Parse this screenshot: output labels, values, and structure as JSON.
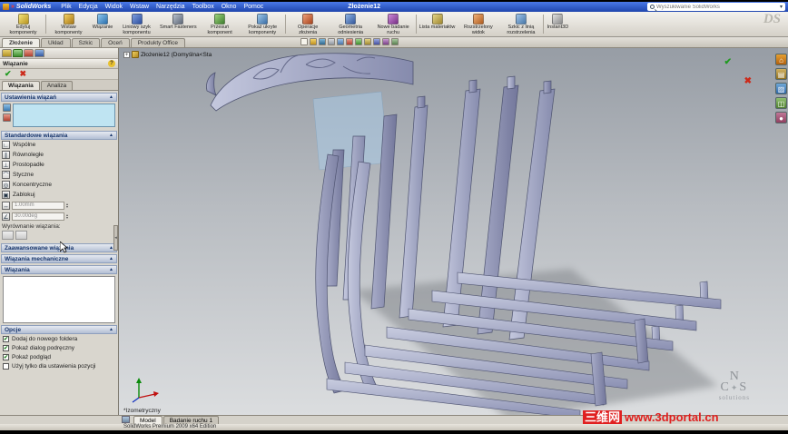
{
  "window": {
    "app": "SolidWorks",
    "doc_title": "Złożenie12",
    "search_placeholder": "Wyszukiwanie SolidWorks"
  },
  "menubar": {
    "items": [
      "Plik",
      "Edycja",
      "Widok",
      "Wstaw",
      "Narzędzia",
      "Toolbox",
      "Okno",
      "Pomoc"
    ]
  },
  "ribbon": {
    "buttons": [
      {
        "label": "Edytuj komponenty",
        "icon": "edit-component"
      },
      {
        "label": "Wstaw komponenty",
        "icon": "insert-component"
      },
      {
        "label": "Wiązanie",
        "icon": "mate"
      },
      {
        "label": "Liniowy szyk komponentu",
        "icon": "linear-component-pattern"
      },
      {
        "label": "Smart Fasteners",
        "icon": "smart-fasteners"
      },
      {
        "label": "Przesuń komponent",
        "icon": "move-component"
      },
      {
        "label": "Pokaż ukryte komponenty",
        "icon": "show-hidden-components"
      },
      {
        "label": "Operacje złożenia",
        "icon": "assembly-features"
      },
      {
        "label": "Geometria odniesienia",
        "icon": "reference-geometry"
      },
      {
        "label": "Nowe badanie ruchu",
        "icon": "new-motion-study"
      },
      {
        "label": "Lista materiałów",
        "icon": "bill-of-materials"
      },
      {
        "label": "Rozstrzelony widok",
        "icon": "exploded-view"
      },
      {
        "label": "Szkic z linią rozstrzelenia",
        "icon": "explode-line-sketch"
      },
      {
        "label": "Instant3D",
        "icon": "instant3d"
      }
    ]
  },
  "command_tabs": {
    "items": [
      "Złożenie",
      "Układ",
      "Szkic",
      "Oceń",
      "Produkty Office"
    ],
    "active": "Złożenie"
  },
  "feature_tree": {
    "root": "Złożenie12 (Domyślna<Sta",
    "expander": "+"
  },
  "property_manager": {
    "title": "Wiązanie",
    "ok": "✔",
    "cancel": "✖",
    "help": "?",
    "tabs": [
      {
        "label": "Wiązania"
      },
      {
        "label": "Analiza"
      }
    ],
    "selections": {
      "header": "Ustawienia wiązań"
    },
    "standard": {
      "header": "Standardowe wiązania",
      "items": [
        {
          "label": "Wspólne",
          "glyph": "∟"
        },
        {
          "label": "Równoległe",
          "glyph": "∥"
        },
        {
          "label": "Prostopadłe",
          "glyph": "⊥"
        },
        {
          "label": "Styczne",
          "glyph": "⌒"
        },
        {
          "label": "Koncentryczne",
          "glyph": "◎"
        },
        {
          "label": "Zablokuj",
          "glyph": "▣"
        }
      ],
      "distance": {
        "glyph": "↔",
        "value": "1.00mm"
      },
      "angle": {
        "glyph": "∠",
        "value": "30.00deg"
      },
      "alignment_label": "Wyrównanie wiązania:"
    },
    "advanced": {
      "header": "Zaawansowane wiązania"
    },
    "mechanical": {
      "header": "Wiązania mechaniczne"
    },
    "mates": {
      "header": "Wiązania"
    },
    "options": {
      "header": "Opcje",
      "checkboxes": [
        {
          "label": "Dodaj do nowego foldera",
          "mark": "✔"
        },
        {
          "label": "Pokaż dialog podręczny",
          "mark": "✔"
        },
        {
          "label": "Pokaż podgląd",
          "mark": "✔"
        },
        {
          "label": "Użyj tylko dla ustawienia pozycji",
          "mark": ""
        }
      ]
    }
  },
  "viewport": {
    "view_label": "*Izometryczny",
    "confirm": "✔",
    "cancel": "✖",
    "ncs": {
      "n": "N",
      "c": "C",
      "star": "✦",
      "s": "S",
      "sub": "solutions"
    }
  },
  "status": {
    "tabs": [
      {
        "label": "Model"
      },
      {
        "label": "Badanie ruchu 1"
      }
    ],
    "active": "Model",
    "text": "SolidWorks Premium 2009 x64 Edition"
  },
  "overlay": {
    "badge": "三维网",
    "url": "www.3dportal.cn"
  },
  "icons": {
    "dropdown": "▾",
    "spin_up": "▴",
    "spin_down": "▾",
    "collapse": "▲",
    "splitter": "◂",
    "taskpane": [
      "⌂",
      "▤",
      "▨",
      "◫",
      "●"
    ]
  },
  "colors": {
    "selection_fill": "#bfe4f2",
    "check_green": "#1f9a1f",
    "cancel_red": "#cc2a1a",
    "watermark_red": "#e02020",
    "titlebar_blue": "#2f5ccc"
  }
}
